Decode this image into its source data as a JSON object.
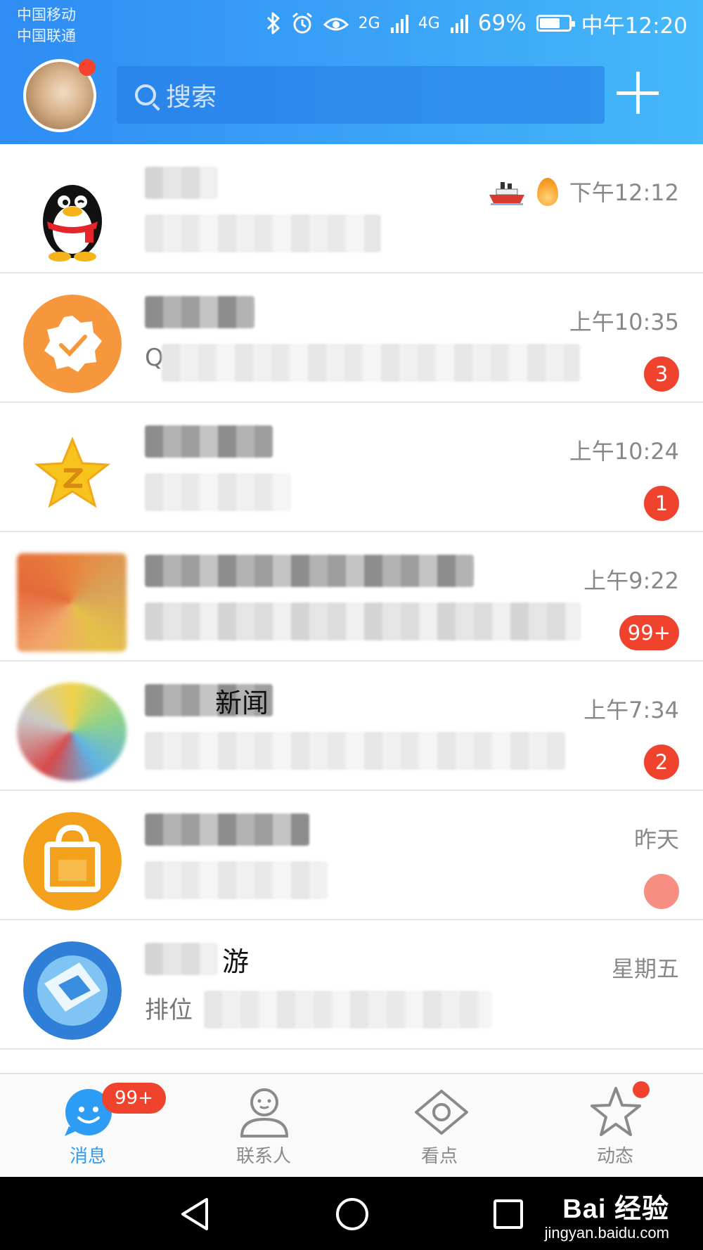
{
  "status_bar": {
    "carrier_1": "中国移动",
    "carrier_2": "中国联通",
    "network_1": "2G",
    "network_2": "4G",
    "battery": "69%",
    "time": "中午12:20"
  },
  "header": {
    "search_placeholder": "搜索"
  },
  "chats": [
    {
      "time": "下午12:12",
      "badge": ""
    },
    {
      "time": "上午10:35",
      "preview_lead": "Q",
      "badge": "3"
    },
    {
      "time": "上午10:24",
      "badge": "1"
    },
    {
      "time": "上午9:22",
      "badge": "99+"
    },
    {
      "name_suffix": "新闻",
      "time": "上午7:34",
      "badge": "2"
    },
    {
      "time": "昨天",
      "badge": ""
    },
    {
      "name_suffix": "游",
      "time": "星期五",
      "preview_lead": "排位",
      "badge": ""
    }
  ],
  "tabs": [
    {
      "label": "消息",
      "badge": "99+"
    },
    {
      "label": "联系人"
    },
    {
      "label": "看点"
    },
    {
      "label": "动态"
    }
  ],
  "watermark": {
    "top": "Bai 经验",
    "bottom": "jingyan.baidu.com"
  },
  "colors": {
    "accent": "#2d9cf5",
    "header_start": "#2f8cf3",
    "header_end": "#45b8fa",
    "badge": "#f0432e"
  }
}
